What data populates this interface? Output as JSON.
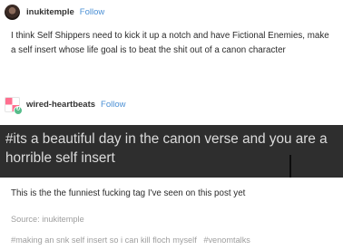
{
  "original_post": {
    "username": "inukitemple",
    "follow_label": "Follow",
    "body": "I think Self Shippers need to kick it up a notch and have Fictional Enemies, make a self insert whose life goal is to beat the shit out of a canon character"
  },
  "reblog": {
    "username": "wired-heartbeats",
    "follow_label": "Follow",
    "image_text": "#its a beautiful day in the canon verse and you are a horrible self insert",
    "body": "This is the the funniest fucking tag I've seen on this post yet"
  },
  "source_line": "Source: inukitemple",
  "tags": [
    "#making an snk self insert so i can kill floch myself",
    "#venomtalks"
  ],
  "colors": {
    "follow": "#4a8fd4",
    "dark_box": "#2e2e2e",
    "muted_text": "#9e9e9e"
  },
  "icons": {
    "avatar_1": "avatar-dark-portrait",
    "avatar_2": "avatar-pink-checker",
    "badge": "reblog-badge-icon"
  }
}
